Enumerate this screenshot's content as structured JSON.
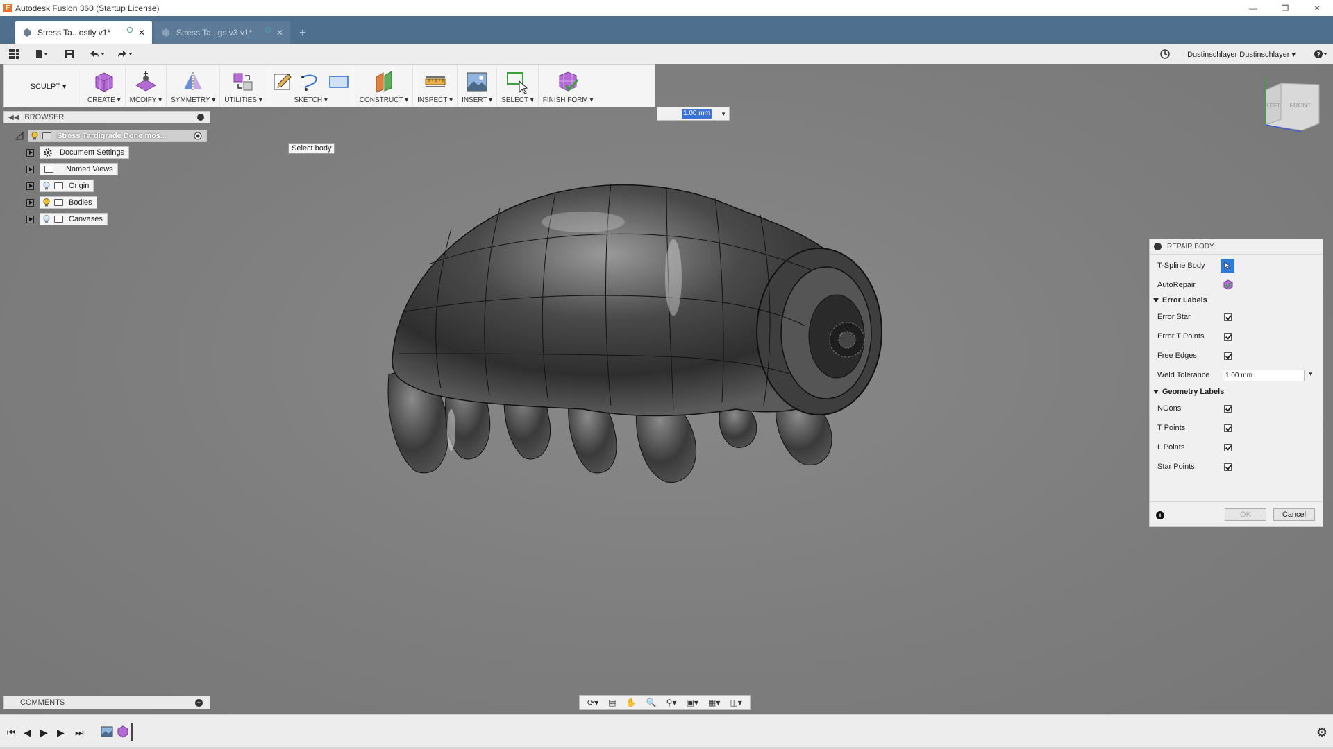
{
  "window": {
    "title": "Autodesk Fusion 360 (Startup License)",
    "app_icon": "F",
    "controls": [
      "minimize-icon",
      "restore-icon",
      "close-icon"
    ]
  },
  "tabs": [
    {
      "label": "Stress Ta...ostly v1*",
      "active": true
    },
    {
      "label": "Stress Ta...gs v3 v1*",
      "active": false
    }
  ],
  "quick_access": {
    "user": "Dustinschlayer Dustinschlayer ▾",
    "icons": [
      "apps-grid-icon",
      "file-icon",
      "save-icon",
      "undo-icon",
      "redo-icon",
      "clock-icon",
      "help-icon"
    ]
  },
  "toolbar": {
    "workspace": "SCULPT ▾",
    "groups": [
      {
        "label": "CREATE ▾"
      },
      {
        "label": "MODIFY ▾"
      },
      {
        "label": "SYMMETRY ▾"
      },
      {
        "label": "UTILITIES ▾"
      },
      {
        "label": "SKETCH ▾"
      },
      {
        "label": "CONSTRUCT ▾"
      },
      {
        "label": "INSPECT ▾"
      },
      {
        "label": "INSERT ▾"
      },
      {
        "label": "SELECT ▾"
      },
      {
        "label": "FINISH FORM ▾"
      }
    ]
  },
  "browser": {
    "header": "BROWSER",
    "root": "Stress Tardigrade Done mos...",
    "items": [
      {
        "label": "Document Settings"
      },
      {
        "label": "Named Views"
      },
      {
        "label": "Origin"
      },
      {
        "label": "Bodies"
      },
      {
        "label": "Canvases"
      }
    ]
  },
  "tooltip": "Select body",
  "value_input": "1.00 mm",
  "viewcube": {
    "left": "LEFT",
    "front": "FRONT"
  },
  "repair_body": {
    "title": "REPAIR BODY",
    "tspline_body": "T-Spline Body",
    "autorepair": "AutoRepair",
    "error_labels": {
      "title": "Error Labels",
      "items": [
        "Error Star",
        "Error T Points",
        "Free Edges"
      ]
    },
    "weld_tolerance": {
      "label": "Weld Tolerance",
      "value": "1.00 mm"
    },
    "geometry_labels": {
      "title": "Geometry Labels",
      "items": [
        "NGons",
        "T Points",
        "L Points",
        "Star Points"
      ]
    },
    "ok": "OK",
    "cancel": "Cancel"
  },
  "comments": "COMMENTS",
  "colors": {
    "canvas": "#7f7f7f",
    "tab_bar": "#4f6f8f",
    "accent": "#2f7bd8"
  }
}
